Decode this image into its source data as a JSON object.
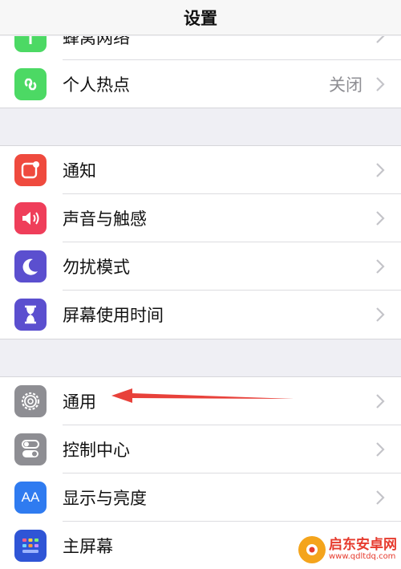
{
  "nav": {
    "title": "设置"
  },
  "group1": {
    "partial_label": "蜂窝网络",
    "hotspot_label": "个人热点",
    "hotspot_value": "关闭"
  },
  "group2": {
    "items": [
      {
        "label": "通知",
        "color": "#ef4a3e",
        "icon": "notifications-icon"
      },
      {
        "label": "声音与触感",
        "color": "#ef3e5a",
        "icon": "speaker-icon"
      },
      {
        "label": "勿扰模式",
        "color": "#5b4fcf",
        "icon": "moon-icon"
      },
      {
        "label": "屏幕使用时间",
        "color": "#5b4fcf",
        "icon": "hourglass-icon"
      }
    ]
  },
  "group3": {
    "items": [
      {
        "label": "通用",
        "color": "#8e8e93",
        "icon": "gear-icon"
      },
      {
        "label": "控制中心",
        "color": "#8e8e93",
        "icon": "toggles-icon"
      },
      {
        "label": "显示与亮度",
        "color": "#2f7bf0",
        "icon": "text-size-icon",
        "icon_text": "AA"
      },
      {
        "label": "主屏幕",
        "color": "#2f55d6",
        "icon": "home-screen-icon"
      }
    ]
  },
  "annotation": {
    "arrow_color": "#e8413a"
  },
  "watermark": {
    "name": "启东安卓网",
    "url": "www.qdltdq.com"
  }
}
